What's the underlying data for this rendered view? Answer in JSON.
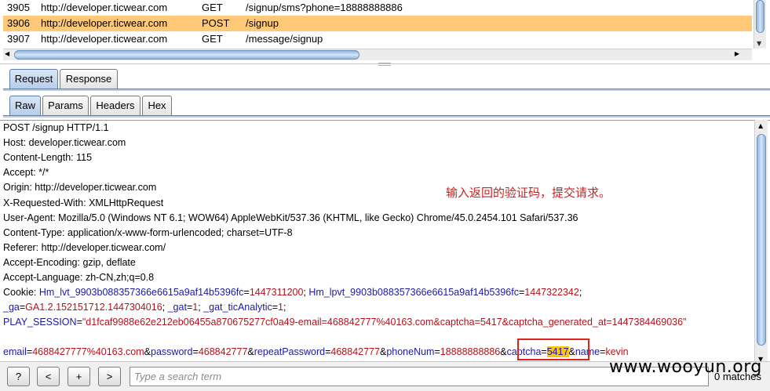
{
  "history": {
    "rows": [
      {
        "id": "3905",
        "host": "http://developer.ticwear.com",
        "method": "GET",
        "url": "/signup/sms?phone=18888888886",
        "selected": false
      },
      {
        "id": "3906",
        "host": "http://developer.ticwear.com",
        "method": "POST",
        "url": "/signup",
        "selected": true
      },
      {
        "id": "3907",
        "host": "http://developer.ticwear.com",
        "method": "GET",
        "url": "/message/signup",
        "selected": false
      }
    ]
  },
  "tabs": {
    "outer": [
      {
        "label": "Request",
        "active": true
      },
      {
        "label": "Response",
        "active": false
      }
    ],
    "inner": [
      {
        "label": "Raw",
        "active": true
      },
      {
        "label": "Params",
        "active": false
      },
      {
        "label": "Headers",
        "active": false
      },
      {
        "label": "Hex",
        "active": false
      }
    ]
  },
  "request": {
    "lines": [
      "POST /signup HTTP/1.1",
      "Host: developer.ticwear.com",
      "Content-Length: 115",
      "Accept: */*",
      "Origin: http://developer.ticwear.com",
      "X-Requested-With: XMLHttpRequest",
      "User-Agent: Mozilla/5.0 (Windows NT 6.1; WOW64) AppleWebKit/537.36 (KHTML, like Gecko) Chrome/45.0.2454.101 Safari/537.36",
      "Content-Type: application/x-www-form-urlencoded; charset=UTF-8",
      "Referer: http://developer.ticwear.com/",
      "Accept-Encoding: gzip, deflate",
      "Accept-Language: zh-CN,zh;q=0.8"
    ],
    "cookie": {
      "label": "Cookie: ",
      "line1": [
        {
          "k": "Hm_lvt_9903b088357366e6615a9af14b5396fc",
          "v": "1447311200",
          "sep": "; "
        },
        {
          "k": "Hm_lpvt_9903b088357366e6615a9af14b5396fc",
          "v": "1447322342",
          "sep": ";"
        }
      ],
      "line2": [
        {
          "k": "_ga",
          "v": "GA1.2.152151712.1447304016",
          "sep": "; "
        },
        {
          "k": "_gat",
          "v": "1",
          "sep": "; "
        },
        {
          "k": "_gat_ticAnalytic",
          "v": "1",
          "sep": ";"
        }
      ],
      "line3": [
        {
          "k": "PLAY_SESSION",
          "v": "\"d1fcaf9988e62e212eb06455a870675277cf0a49-email=468842777%40163.com&captcha=5417&captcha_generated_at=1447384469036\"",
          "sep": ""
        }
      ]
    },
    "body": [
      {
        "k": "email",
        "v": "4688427777%40163.com",
        "sep": "&"
      },
      {
        "k": "password",
        "v": "468842777",
        "sep": "&"
      },
      {
        "k": "repeatPassword",
        "v": "468842777",
        "sep": "&"
      },
      {
        "k": "phoneNum",
        "v": "18888888886",
        "sep": "&"
      },
      {
        "k": "captcha",
        "v": "5417",
        "sep": "&",
        "highlight": true
      },
      {
        "k": "name",
        "v": "kevin",
        "sep": ""
      }
    ]
  },
  "annotation": "输入返回的验证码，提交请求。",
  "toolbar": {
    "help_label": "?",
    "prev_label": "<",
    "add_label": "+",
    "next_label": ">",
    "search_placeholder": "Type a search term",
    "matches": "0 matches"
  },
  "watermark": "www.wooyun.org",
  "colors": {
    "selected_row": "#ffc977",
    "param_name": "#1a1aa6",
    "param_value": "#b5121b",
    "highlight": "#ffc300",
    "annotation": "#d11e1e"
  }
}
